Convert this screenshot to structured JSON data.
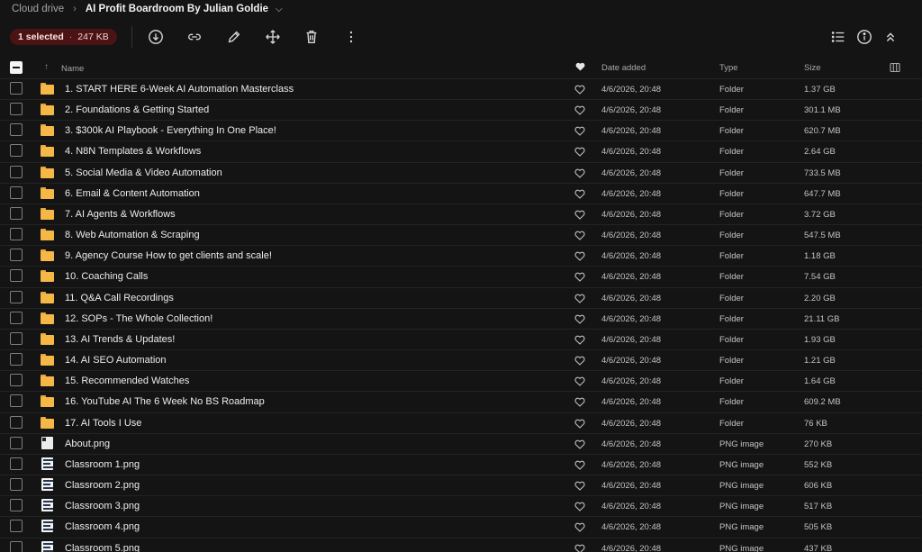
{
  "breadcrumb": {
    "root": "Cloud drive",
    "current": "AI Profit Boardroom By Julian Goldie"
  },
  "selection": {
    "count_label": "1 selected",
    "size": "247 KB"
  },
  "toolbar": {
    "actions": [
      "download-icon",
      "link-icon",
      "rename-icon",
      "move-icon",
      "delete-icon",
      "more-icon"
    ],
    "right_actions": [
      "list-view-icon",
      "info-icon",
      "collapse-icon"
    ]
  },
  "columns": {
    "name": "Name",
    "date": "Date added",
    "type": "Type",
    "size": "Size"
  },
  "colors": {
    "accent_badge": "#4b1313",
    "folder": "#f5b746",
    "background": "#141414"
  },
  "rows": [
    {
      "name": "1. START HERE 6-Week AI Automation Masterclass",
      "date": "4/6/2026, 20:48",
      "type": "Folder",
      "size": "1.37 GB",
      "icon": "folder"
    },
    {
      "name": "2. Foundations & Getting Started",
      "date": "4/6/2026, 20:48",
      "type": "Folder",
      "size": "301.1 MB",
      "icon": "folder"
    },
    {
      "name": "3. $300k AI Playbook - Everything In One Place!",
      "date": "4/6/2026, 20:48",
      "type": "Folder",
      "size": "620.7 MB",
      "icon": "folder"
    },
    {
      "name": "4. N8N Templates & Workflows",
      "date": "4/6/2026, 20:48",
      "type": "Folder",
      "size": "2.64 GB",
      "icon": "folder"
    },
    {
      "name": "5. Social Media & Video Automation",
      "date": "4/6/2026, 20:48",
      "type": "Folder",
      "size": "733.5 MB",
      "icon": "folder"
    },
    {
      "name": "6. Email & Content Automation",
      "date": "4/6/2026, 20:48",
      "type": "Folder",
      "size": "647.7 MB",
      "icon": "folder"
    },
    {
      "name": "7. AI Agents & Workflows",
      "date": "4/6/2026, 20:48",
      "type": "Folder",
      "size": "3.72 GB",
      "icon": "folder"
    },
    {
      "name": "8. Web Automation & Scraping",
      "date": "4/6/2026, 20:48",
      "type": "Folder",
      "size": "547.5 MB",
      "icon": "folder"
    },
    {
      "name": "9. Agency Course How to get clients and scale!",
      "date": "4/6/2026, 20:48",
      "type": "Folder",
      "size": "1.18 GB",
      "icon": "folder"
    },
    {
      "name": "10. Coaching Calls",
      "date": "4/6/2026, 20:48",
      "type": "Folder",
      "size": "7.54 GB",
      "icon": "folder"
    },
    {
      "name": "11. Q&A Call Recordings",
      "date": "4/6/2026, 20:48",
      "type": "Folder",
      "size": "2.20 GB",
      "icon": "folder"
    },
    {
      "name": "12. SOPs - The Whole Collection!",
      "date": "4/6/2026, 20:48",
      "type": "Folder",
      "size": "21.11 GB",
      "icon": "folder"
    },
    {
      "name": "13. AI Trends & Updates!",
      "date": "4/6/2026, 20:48",
      "type": "Folder",
      "size": "1.93 GB",
      "icon": "folder"
    },
    {
      "name": "14. AI SEO Automation",
      "date": "4/6/2026, 20:48",
      "type": "Folder",
      "size": "1.21 GB",
      "icon": "folder"
    },
    {
      "name": "15. Recommended Watches",
      "date": "4/6/2026, 20:48",
      "type": "Folder",
      "size": "1.64 GB",
      "icon": "folder"
    },
    {
      "name": "16. YouTube AI The 6 Week No BS Roadmap",
      "date": "4/6/2026, 20:48",
      "type": "Folder",
      "size": "609.2 MB",
      "icon": "folder"
    },
    {
      "name": "17. AI Tools I Use",
      "date": "4/6/2026, 20:48",
      "type": "Folder",
      "size": "76 KB",
      "icon": "folder"
    },
    {
      "name": "About.png",
      "date": "4/6/2026, 20:48",
      "type": "PNG image",
      "size": "270 KB",
      "icon": "image-about"
    },
    {
      "name": "Classroom 1.png",
      "date": "4/6/2026, 20:48",
      "type": "PNG image",
      "size": "552 KB",
      "icon": "image"
    },
    {
      "name": "Classroom 2.png",
      "date": "4/6/2026, 20:48",
      "type": "PNG image",
      "size": "606 KB",
      "icon": "image"
    },
    {
      "name": "Classroom 3.png",
      "date": "4/6/2026, 20:48",
      "type": "PNG image",
      "size": "517 KB",
      "icon": "image"
    },
    {
      "name": "Classroom 4.png",
      "date": "4/6/2026, 20:48",
      "type": "PNG image",
      "size": "505 KB",
      "icon": "image"
    },
    {
      "name": "Classroom 5.png",
      "date": "4/6/2026, 20:48",
      "type": "PNG image",
      "size": "437 KB",
      "icon": "image"
    }
  ]
}
